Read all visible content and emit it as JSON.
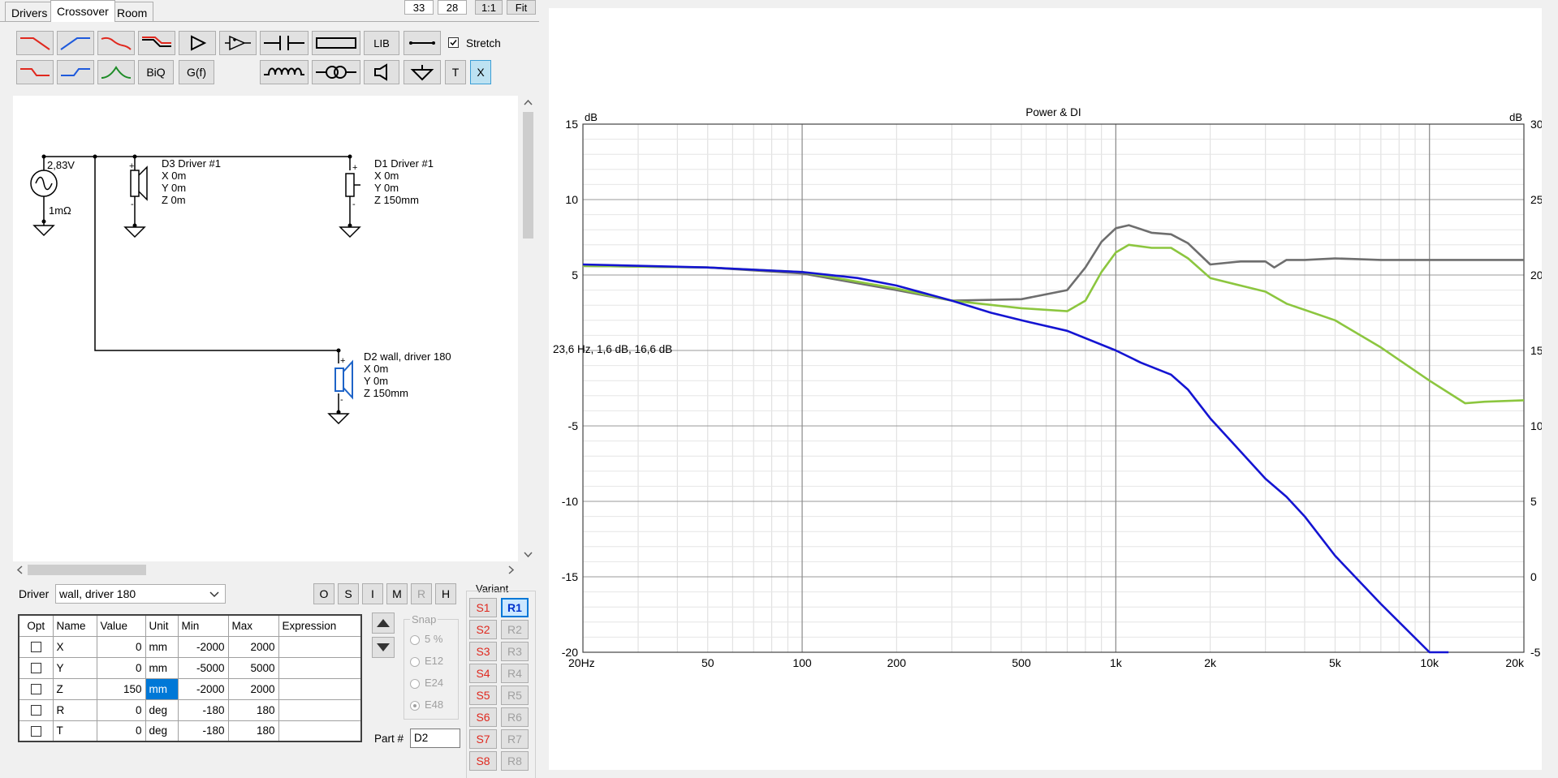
{
  "tabs": [
    "Drivers",
    "Crossover",
    "Room"
  ],
  "active_tab": "Crossover",
  "top_controls": {
    "box1": "33",
    "box2": "28",
    "btn_one_to_one": "1:1",
    "btn_fit": "Fit"
  },
  "toolbar": {
    "stretch_label": "Stretch",
    "stretch_checked": true,
    "lib_label": "LIB",
    "biq_label": "BiQ",
    "gf_label": "G(f)",
    "t_label": "T",
    "x_label": "X"
  },
  "schematic": {
    "source": {
      "voltage": "2,83V",
      "impedance": "1mΩ"
    },
    "d3": {
      "name": "D3 Driver #1",
      "x": "X 0m",
      "y": "Y 0m",
      "z": "Z 0m"
    },
    "d1": {
      "name": "D1 Driver #1",
      "x": "X 0m",
      "y": "Y 0m",
      "z": "Z 150mm"
    },
    "d2": {
      "name": "D2 wall, driver 180",
      "x": "X 0m",
      "y": "Y 0m",
      "z": "Z 150mm"
    }
  },
  "driver_panel": {
    "driver_label": "Driver",
    "driver_value": "wall, driver 180",
    "mode_buttons": [
      "O",
      "S",
      "I",
      "M",
      "R",
      "H"
    ],
    "columns": [
      "Opt",
      "Name",
      "Value",
      "Unit",
      "Min",
      "Max",
      "Expression"
    ],
    "rows": [
      {
        "name": "X",
        "value": "0",
        "unit": "mm",
        "min": "-2000",
        "max": "2000",
        "expression": ""
      },
      {
        "name": "Y",
        "value": "0",
        "unit": "mm",
        "min": "-5000",
        "max": "5000",
        "expression": ""
      },
      {
        "name": "Z",
        "value": "150",
        "unit": "mm",
        "min": "-2000",
        "max": "2000",
        "expression": ""
      },
      {
        "name": "R",
        "value": "0",
        "unit": "deg",
        "min": "-180",
        "max": "180",
        "expression": ""
      },
      {
        "name": "T",
        "value": "0",
        "unit": "deg",
        "min": "-180",
        "max": "180",
        "expression": ""
      }
    ],
    "snap_label": "Snap",
    "snap_options": [
      "5 %",
      "E12",
      "E24",
      "E48"
    ],
    "snap_selected": "E48",
    "part_label": "Part #",
    "part_value": "D2"
  },
  "variant": {
    "label": "Variant",
    "s_buttons": [
      "S1",
      "S2",
      "S3",
      "S4",
      "S5",
      "S6",
      "S7",
      "S8"
    ],
    "r_buttons": [
      "R1",
      "R2",
      "R3",
      "R4",
      "R5",
      "R6",
      "R7",
      "R8"
    ],
    "selected": "R1"
  },
  "colors": {
    "gray_curve": "#6e6e6e",
    "green_curve": "#8cc63f",
    "blue_curve": "#1414d2",
    "accent": "#0078d7",
    "red_icon": "#e0281e"
  },
  "chart_data": {
    "type": "line",
    "title": "Power & DI",
    "ylabel_left": "dB",
    "ylabel_right": "dB",
    "x_scale": "log",
    "xlim": [
      20,
      20000
    ],
    "ylim_left": [
      -20,
      15
    ],
    "ylim_right": [
      -5,
      30
    ],
    "x_ticks": [
      20,
      50,
      100,
      200,
      500,
      1000,
      2000,
      5000,
      10000,
      20000
    ],
    "x_tick_labels": [
      "20Hz",
      "50",
      "100",
      "200",
      "500",
      "1k",
      "2k",
      "5k",
      "10k",
      "20k"
    ],
    "y_left_ticks": [
      -20,
      -15,
      -10,
      -5,
      0,
      5,
      10,
      15
    ],
    "y_left_tick_labels": [
      "-20",
      "-15",
      "-10",
      "-5",
      "",
      "5",
      "10",
      "15"
    ],
    "y_right_ticks": [
      -5,
      0,
      5,
      10,
      15,
      20,
      25,
      30
    ],
    "y_right_tick_labels": [
      "-5",
      "0",
      "5",
      "10",
      "15",
      "20",
      "25",
      "30"
    ],
    "cursor_readout": "23,6 Hz, 1,6 dB, 16,6 dB",
    "grid": true,
    "series": [
      {
        "color": "#6e6e6e",
        "axis": "left",
        "x": [
          20,
          50,
          100,
          200,
          300,
          500,
          700,
          800,
          900,
          1000,
          1100,
          1300,
          1500,
          1700,
          2000,
          2500,
          3000,
          3200,
          3500,
          4000,
          5000,
          7000,
          10000,
          15000,
          20000
        ],
        "y": [
          5.6,
          5.5,
          5.1,
          4.0,
          3.3,
          3.4,
          4.0,
          5.5,
          7.2,
          8.1,
          8.3,
          7.8,
          7.7,
          7.1,
          5.7,
          5.9,
          5.9,
          5.5,
          6.0,
          6.0,
          6.1,
          6.0,
          6.0,
          6.0,
          6.0
        ]
      },
      {
        "color": "#8cc63f",
        "axis": "right",
        "x": [
          20,
          50,
          100,
          200,
          300,
          500,
          700,
          800,
          900,
          1000,
          1100,
          1300,
          1500,
          1700,
          2000,
          2500,
          3000,
          3500,
          5000,
          7000,
          10000,
          13000,
          15000,
          20000
        ],
        "y": [
          20.6,
          20.5,
          20.2,
          19.1,
          18.3,
          17.8,
          17.6,
          18.3,
          20.2,
          21.5,
          22.0,
          21.8,
          21.8,
          21.1,
          19.8,
          19.3,
          18.9,
          18.1,
          17.0,
          15.2,
          13.0,
          11.5,
          11.6,
          11.7
        ]
      },
      {
        "color": "#1414d2",
        "axis": "left",
        "x": [
          20,
          50,
          100,
          150,
          200,
          300,
          400,
          500,
          700,
          1000,
          1200,
          1500,
          1700,
          2000,
          2500,
          3000,
          3500,
          4000,
          5000,
          7000,
          10000,
          11500
        ],
        "y": [
          5.7,
          5.5,
          5.2,
          4.8,
          4.3,
          3.3,
          2.5,
          2.0,
          1.3,
          0.0,
          -0.8,
          -1.6,
          -2.6,
          -4.5,
          -6.7,
          -8.5,
          -9.7,
          -11.0,
          -13.6,
          -16.8,
          -20.2,
          -21.5
        ]
      }
    ]
  }
}
